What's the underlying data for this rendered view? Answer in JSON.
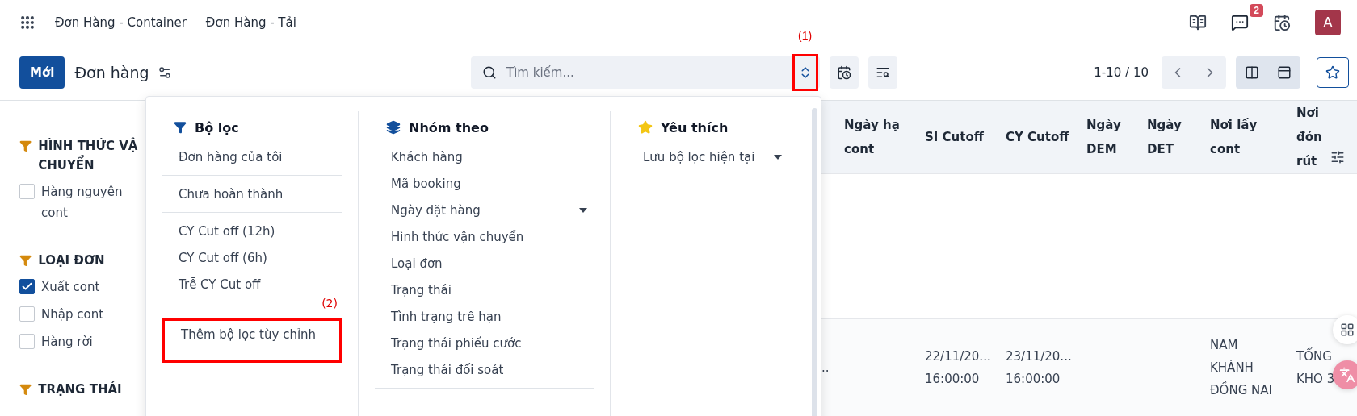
{
  "top_nav": {
    "menu_items": [
      "Đơn Hàng - Container",
      "Đơn Hàng - Tải"
    ],
    "message_count": "2",
    "avatar_initial": "A"
  },
  "control_panel": {
    "new_button": "Mới",
    "breadcrumb": "Đơn hàng",
    "search": {
      "placeholder": "Tìm kiếm...",
      "toggle_annotation": "(1)"
    },
    "pager": "1-10 / 10"
  },
  "sidebar": {
    "sections": [
      {
        "title": "HÌNH THỨC VẬ CHUYỂN",
        "options": [
          {
            "label": "Hàng nguyên cont",
            "checked": false
          }
        ]
      },
      {
        "title": "LOẠI ĐƠN",
        "options": [
          {
            "label": "Xuất cont",
            "checked": true
          },
          {
            "label": "Nhập cont",
            "checked": false
          },
          {
            "label": "Hàng rời",
            "checked": false
          }
        ]
      },
      {
        "title": "TRẠNG THÁI"
      }
    ]
  },
  "search_panel": {
    "filters": {
      "title": "Bộ lọc",
      "groups": [
        {
          "items": [
            {
              "label": "Đơn hàng của tôi"
            }
          ]
        },
        {
          "items": [
            {
              "label": "Chưa hoàn thành"
            }
          ]
        },
        {
          "items": [
            {
              "label": "CY Cut off (12h)"
            },
            {
              "label": "CY Cut off (6h)"
            },
            {
              "label": "Trễ CY Cut off"
            }
          ]
        },
        {
          "items": [
            {
              "label": "Thêm bộ lọc tùy chỉnh",
              "annotation": "(2)"
            }
          ]
        }
      ]
    },
    "group_by": {
      "title": "Nhóm theo",
      "items": [
        {
          "label": "Khách hàng",
          "has_submenu": false
        },
        {
          "label": "Mã booking",
          "has_submenu": false
        },
        {
          "label": "Ngày đặt hàng",
          "has_submenu": true
        },
        {
          "label": "Hình thức vận chuyển",
          "has_submenu": false
        },
        {
          "label": "Loại đơn",
          "has_submenu": false
        },
        {
          "label": "Trạng thái",
          "has_submenu": false
        },
        {
          "label": "Tình trạng trễ hạn",
          "has_submenu": false
        },
        {
          "label": "Trạng thái phiếu cước",
          "has_submenu": false
        },
        {
          "label": "Trạng thái đối soát",
          "has_submenu": false
        }
      ]
    },
    "favorites": {
      "title": "Yêu thích",
      "items": [
        {
          "label": "Lưu bộ lọc hiện tại",
          "has_submenu": true
        }
      ]
    }
  },
  "table": {
    "columns": [
      "Ngày hạ cont",
      "SI Cutoff",
      "CY Cutoff",
      "Ngày DEM",
      "Ngày DET",
      "Nơi lấy cont",
      "Nơi đón rút"
    ],
    "rows": [
      {
        "clipped_cell": "..",
        "cells": [
          null,
          [
            "22/11/20...",
            "16:00:00"
          ],
          [
            "23/11/20...",
            "16:00:00"
          ],
          null,
          null,
          [
            "NAM",
            "KHÁNH",
            "ĐỒNG NAI"
          ],
          [
            "TỔNG",
            "KHO 3"
          ]
        ]
      }
    ]
  }
}
